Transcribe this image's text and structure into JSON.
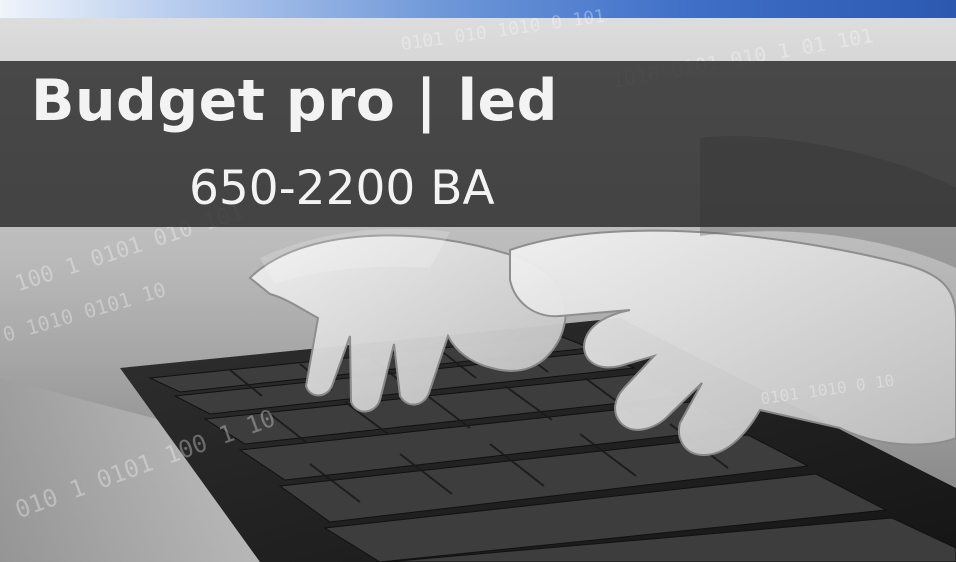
{
  "banner": {
    "title": "Budget pro | led",
    "subtitle_range": "650-2200",
    "subtitle_unit": "BA"
  }
}
